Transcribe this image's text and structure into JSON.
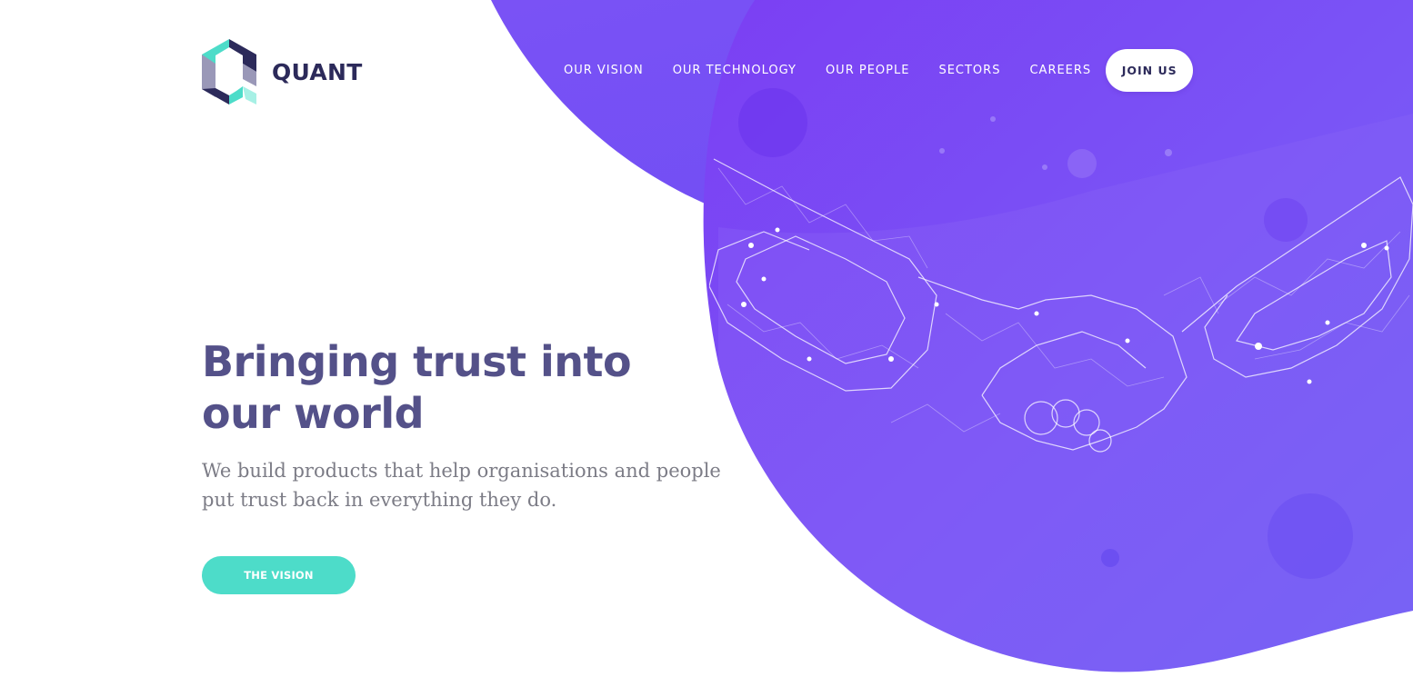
{
  "brand": {
    "name": "QUANT",
    "colors": {
      "navy": "#2c2a5a",
      "teal": "#4ddcc9",
      "purple": "#7b4cf6",
      "headline": "#545189"
    }
  },
  "nav": {
    "items": [
      {
        "label": "OUR VISION",
        "name": "nav-our-vision"
      },
      {
        "label": "OUR TECHNOLOGY",
        "name": "nav-our-technology"
      },
      {
        "label": "OUR PEOPLE",
        "name": "nav-our-people"
      },
      {
        "label": "SECTORS",
        "name": "nav-sectors"
      },
      {
        "label": "CAREERS",
        "name": "nav-careers"
      }
    ],
    "join_label": "JOIN US"
  },
  "hero": {
    "headline_line1": "Bringing trust into",
    "headline_line2": "our world",
    "subtext_line1": "We build products that help organisations and people",
    "subtext_line2": "put trust back in everything they do.",
    "cta_label": "THE VISION",
    "illustration_icon": "chain-handshake-illustration"
  }
}
